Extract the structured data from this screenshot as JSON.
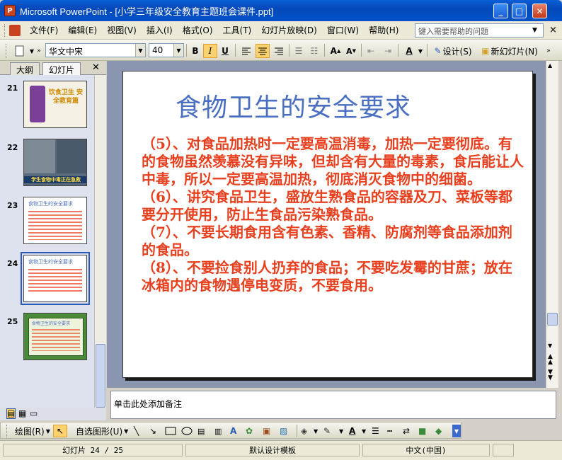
{
  "window": {
    "title": "Microsoft PowerPoint - [小学三年级安全教育主题班会课件.ppt]",
    "app_icon_letter": "P",
    "minimize": "_",
    "maximize": "□",
    "close": "✕"
  },
  "menu": {
    "items": [
      "文件(F)",
      "编辑(E)",
      "视图(V)",
      "插入(I)",
      "格式(O)",
      "工具(T)",
      "幻灯片放映(D)",
      "窗口(W)",
      "帮助(H)"
    ],
    "help_placeholder": "键入需要帮助的问题"
  },
  "toolbar": {
    "font_name": "华文中宋",
    "font_size": "40",
    "bold": "B",
    "italic": "I",
    "underline": "U",
    "font_color_label": "A",
    "design_label": "设计(S)",
    "new_slide_label": "新幻灯片(N)"
  },
  "panel": {
    "tabs": [
      "大纲",
      "幻灯片"
    ],
    "active_tab": "幻灯片",
    "slides": [
      {
        "num": "21",
        "caption": "饮食卫生 安全教育篇"
      },
      {
        "num": "22",
        "caption": "学生食物中毒正在急救"
      },
      {
        "num": "23",
        "caption": "食物卫生的安全要求"
      },
      {
        "num": "24",
        "caption": "食物卫生的安全要求",
        "selected": true
      },
      {
        "num": "25",
        "caption": "食物卫生的安全要求"
      }
    ]
  },
  "slide": {
    "title": "食物卫生的安全要求",
    "paragraphs": [
      "（5）、对食品加热时一定要高温消毒，加热一定要彻底。有的食物虽然羡慕没有异味，但却含有大量的毒素，食后能让人中毒，所以一定要高温加热，彻底消灭食物中的细菌。",
      "（6）、讲究食品卫生，盛放生熟食品的容器及刀、菜板等都要分开使用，防止生食品污染熟食品。",
      "（7）、不要长期食用含有色素、香精、防腐剂等食品添加剂的食品。",
      "（8）、不要捡食别人扔弃的食品；不要吃发霉的甘蔗；放在冰箱内的食物遇停电变质，不要食用。"
    ],
    "title_color": "#4a6fc2",
    "body_color": "#e8401e"
  },
  "notes": {
    "placeholder": "单击此处添加备注"
  },
  "drawbar": {
    "draw_label": "绘图(R)",
    "autoshape_label": "自选图形(U)"
  },
  "status": {
    "slide_pos": "幻灯片 24 / 25",
    "template": "默认设计模板",
    "language": "中文(中国)"
  }
}
